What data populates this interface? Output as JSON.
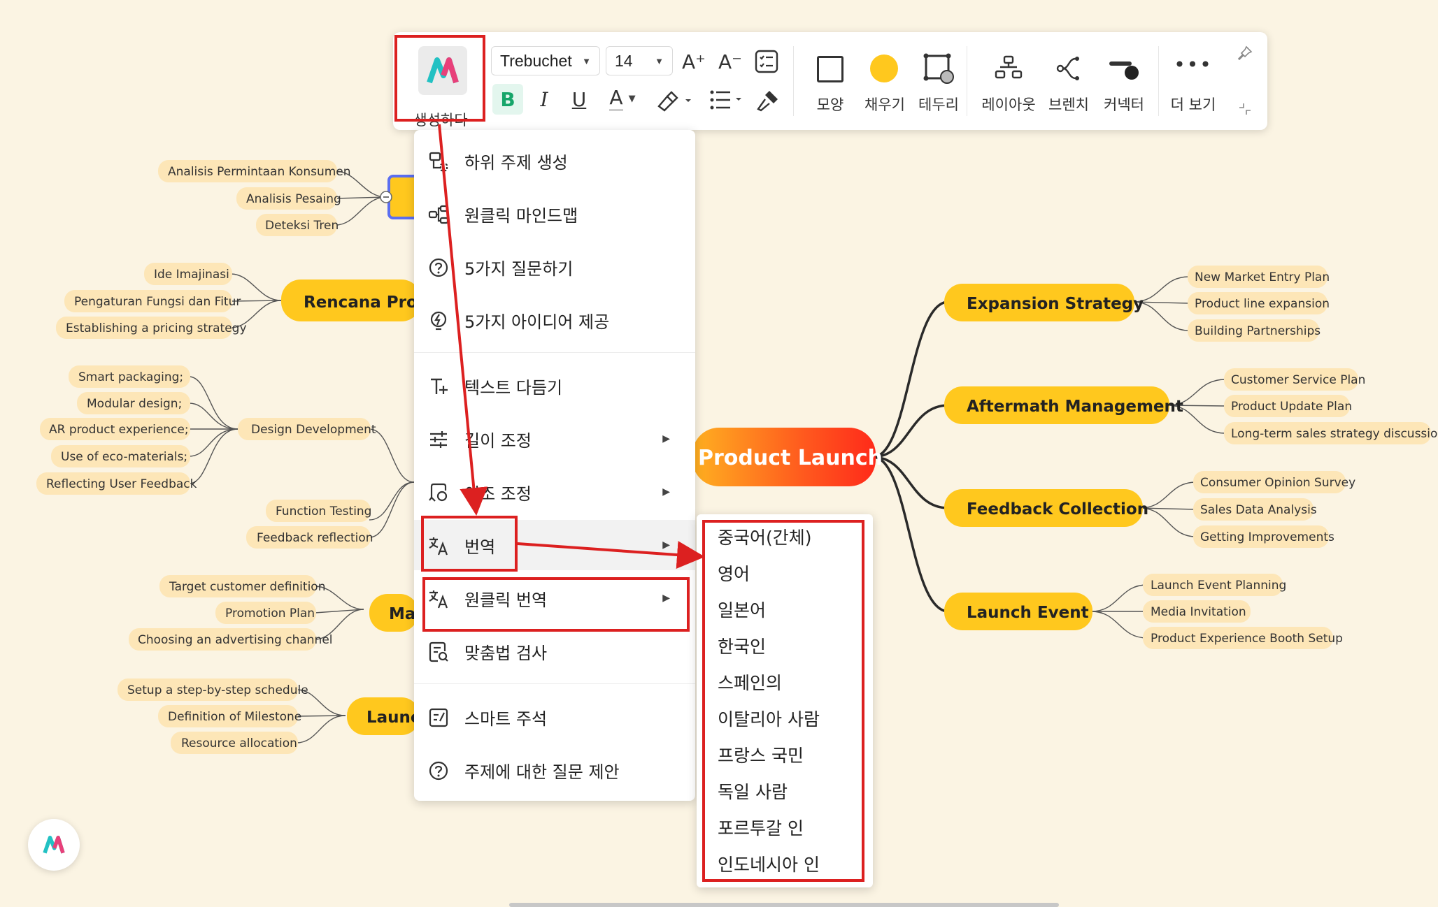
{
  "toolbar": {
    "generate_label": "생성하다",
    "font_family": "Trebuchet",
    "font_size": "14",
    "increase_font": "A⁺",
    "decrease_font": "A⁻",
    "bold": "B",
    "italic": "I",
    "underline": "U",
    "font_color": "A",
    "shape_label": "모양",
    "fill_label": "채우기",
    "border_label": "테두리",
    "layout_label": "레이아웃",
    "branch_label": "브렌치",
    "connector_label": "커넥터",
    "more_label": "더 보기",
    "fill_color": "#ffc81e"
  },
  "context_menu": {
    "items": [
      {
        "label": "하위 주제 생성",
        "icon": "subtopic-icon"
      },
      {
        "label": "원클릭 마인드맵",
        "icon": "mindmap-icon"
      },
      {
        "label": "5가지 질문하기",
        "icon": "question-icon"
      },
      {
        "label": "5가지 아이디어 제공",
        "icon": "idea-bulb-icon"
      },
      {
        "label": "텍스트 다듬기",
        "icon": "text-polish-icon"
      },
      {
        "label": "길이 조정",
        "icon": "length-adjust-icon"
      },
      {
        "label": "어조 조정",
        "icon": "tone-adjust-icon"
      },
      {
        "label": "번역",
        "icon": "translate-icon"
      },
      {
        "label": "원클릭 번역",
        "icon": "translate-icon"
      },
      {
        "label": "맞춤법 검사",
        "icon": "spellcheck-icon"
      },
      {
        "label": "스마트 주석",
        "icon": "smart-note-icon"
      },
      {
        "label": "주제에 대한 질문 제안",
        "icon": "question-icon"
      }
    ]
  },
  "translate_submenu": {
    "items": [
      "중국어(간체)",
      "영어",
      "일본어",
      "한국인",
      "스페인의",
      "이탈리아 사람",
      "프랑스 국민",
      "독일 사람",
      "포르투갈 인",
      "인도네시아 인"
    ]
  },
  "mindmap": {
    "root": "Product Launch",
    "left_visible": [
      {
        "topic": "",
        "leaves": [
          "Analisis Permintaan Konsumen",
          "Analisis Pesaing",
          "Deteksi Tren"
        ]
      },
      {
        "topic": "Rencana Produ",
        "leaves": [
          "Ide Imajinasi",
          "Pengaturan Fungsi dan Fitur",
          "Establishing a pricing strategy"
        ]
      },
      {
        "sub1": "Design Development",
        "sub1_leaves": [
          "Smart packaging;",
          "Modular design;",
          "AR product experience;",
          "Use of eco-materials;",
          "Reflecting User Feedback"
        ],
        "sub_extra": [
          "Function Testing",
          "Feedback reflection"
        ]
      },
      {
        "topic": "Ma",
        "leaves": [
          "Target customer definition",
          "Promotion Plan",
          "Choosing an advertising channel"
        ]
      },
      {
        "topic": "Launc",
        "leaves": [
          "Setup a step-by-step schedule",
          "Definition of Milestone",
          "Resource allocation"
        ]
      }
    ],
    "right": [
      {
        "topic": "Expansion Strategy",
        "leaves": [
          "New Market Entry Plan",
          "Product line expansion",
          "Building Partnerships"
        ]
      },
      {
        "topic": "Aftermath Management",
        "leaves": [
          "Customer Service Plan",
          "Product Update Plan",
          "Long-term sales strategy discussion"
        ]
      },
      {
        "topic": "Feedback Collection",
        "leaves": [
          "Consumer Opinion Survey",
          "Sales Data Analysis",
          "Getting Improvements"
        ]
      },
      {
        "topic": "Launch Event",
        "leaves": [
          "Launch Event Planning",
          "Media Invitation",
          "Product Experience Booth Setup"
        ]
      }
    ]
  },
  "colors": {
    "canvas_bg": "#fbf4e3",
    "topic_fill": "#ffc81e",
    "leaf_fill": "#fde6b7",
    "root_fill": "#ff5a1e",
    "annotation_red": "#dc2020"
  }
}
